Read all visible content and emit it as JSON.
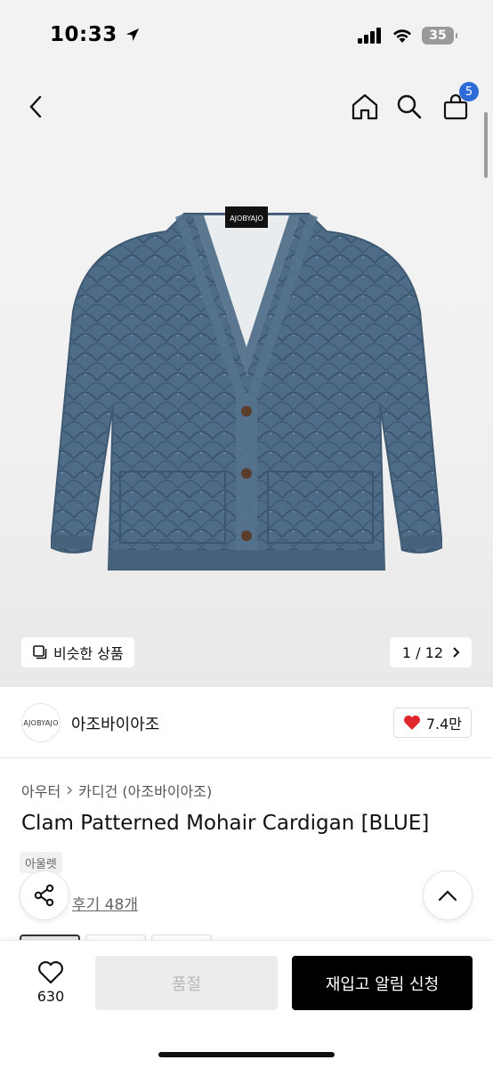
{
  "status_bar": {
    "time": "10:33",
    "battery": "35"
  },
  "nav": {
    "cart_count": "5"
  },
  "gallery": {
    "similar_label": "비슷한 상품",
    "counter": "1 / 12",
    "product_tag": "AJOBYAJO"
  },
  "brand": {
    "logo_text": "AJOBYAJO",
    "name": "아조바이아조",
    "likes": "7.4만"
  },
  "product": {
    "category_parent": "아우터",
    "category_child": "카디건 (아조바이아조)",
    "title": "Clam Patterned Mohair Cardigan [BLUE]",
    "tag": "아울렛",
    "review": "후기 48개"
  },
  "bottom": {
    "like_count": "630",
    "soldout_label": "품절",
    "restock_label": "재입고 알림 신청"
  },
  "colors": {
    "accent_badge": "#2e6bd8",
    "cardigan": "#4c6a85",
    "like_heart": "#e0262b"
  }
}
